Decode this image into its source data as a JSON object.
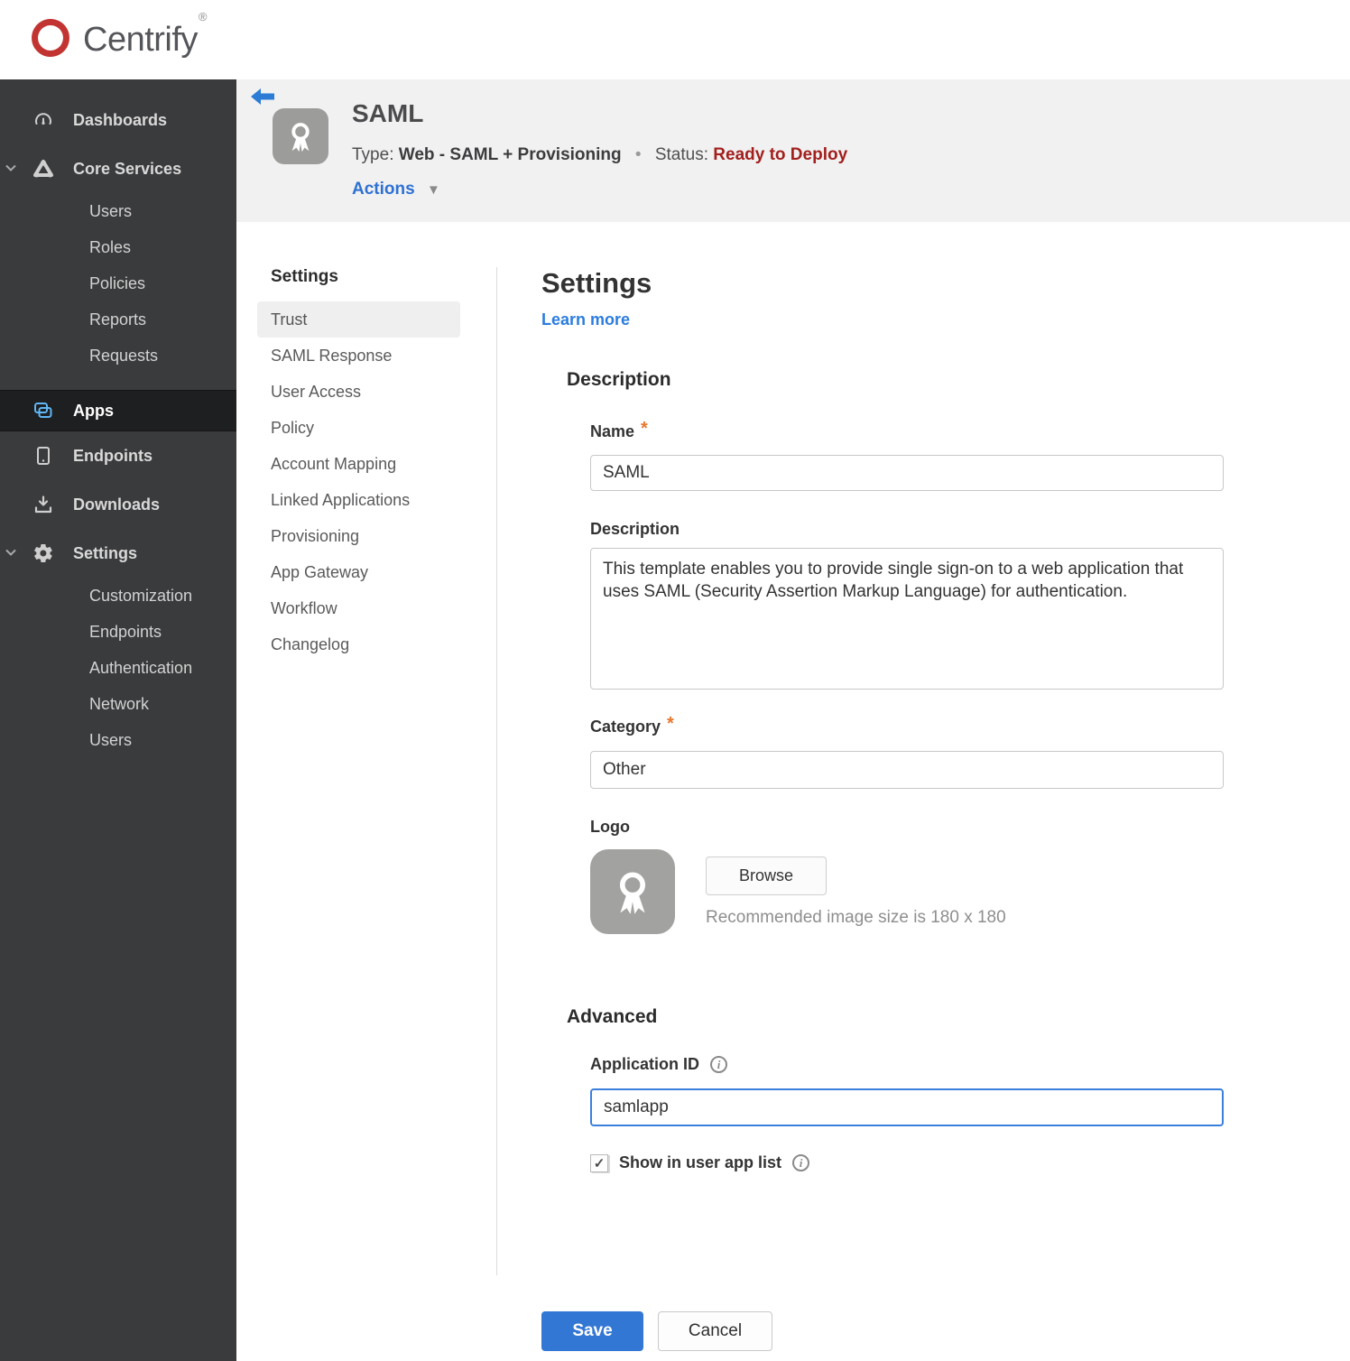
{
  "brand": {
    "name": "Centrify",
    "registered_mark": "®",
    "logo_color": "#c23431"
  },
  "icons": {
    "caret_down": "▼",
    "bullet": "•",
    "check": "✓",
    "info": "i",
    "required": "*"
  },
  "sidebar": {
    "items": [
      {
        "label": "Dashboards",
        "icon": "gauge-icon"
      },
      {
        "label": "Core Services",
        "icon": "core-services-icon",
        "expanded": true
      },
      {
        "label": "Users"
      },
      {
        "label": "Roles"
      },
      {
        "label": "Policies"
      },
      {
        "label": "Reports"
      },
      {
        "label": "Requests"
      },
      {
        "label": "Apps",
        "icon": "apps-icon",
        "active": true
      },
      {
        "label": "Endpoints",
        "icon": "tablet-icon"
      },
      {
        "label": "Downloads",
        "icon": "download-icon"
      },
      {
        "label": "Settings",
        "icon": "gear-icon",
        "expanded": true
      },
      {
        "label": "Customization"
      },
      {
        "label": "Endpoints"
      },
      {
        "label": "Authentication"
      },
      {
        "label": "Network"
      },
      {
        "label": "Users"
      }
    ]
  },
  "header": {
    "app_name": "SAML",
    "type_label": "Type:",
    "type_value": "Web - SAML + Provisioning",
    "status_label": "Status:",
    "status_value": "Ready to Deploy",
    "status_color": "#a2201d",
    "actions_label": "Actions"
  },
  "subnav": {
    "title": "Settings",
    "active_item": "Trust",
    "items": [
      {
        "label": "Trust"
      },
      {
        "label": "SAML Response"
      },
      {
        "label": "User Access"
      },
      {
        "label": "Policy"
      },
      {
        "label": "Account Mapping"
      },
      {
        "label": "Linked Applications"
      },
      {
        "label": "Provisioning"
      },
      {
        "label": "App Gateway"
      },
      {
        "label": "Workflow"
      },
      {
        "label": "Changelog"
      }
    ]
  },
  "main": {
    "title": "Settings",
    "learn_more_label": "Learn more",
    "description_section": {
      "heading": "Description",
      "name_label": "Name",
      "name_value": "SAML",
      "description_label": "Description",
      "description_value": "This template enables you to provide single sign-on to a web application that uses SAML (Security Assertion Markup Language) for authentication.",
      "category_label": "Category",
      "category_value": "Other",
      "logo_label": "Logo",
      "browse_label": "Browse",
      "logo_hint": "Recommended image size is 180 x 180"
    },
    "advanced_section": {
      "heading": "Advanced",
      "application_id_label": "Application ID",
      "application_id_value": "samlapp",
      "show_in_user_app_list_label": "Show in user app list",
      "show_in_user_app_list_checked": true
    },
    "footer": {
      "save_label": "Save",
      "cancel_label": "Cancel"
    }
  },
  "colors": {
    "accent_blue": "#3377d4",
    "link_blue": "#2b7ce0",
    "status_red": "#a2201d",
    "required_orange": "#e8782e",
    "sidebar_bg": "#3a3b3d",
    "sidebar_active_bg": "#1e1f21",
    "apps_icon_blue": "#5fb6f5",
    "header_bg": "#f1f1f2"
  }
}
